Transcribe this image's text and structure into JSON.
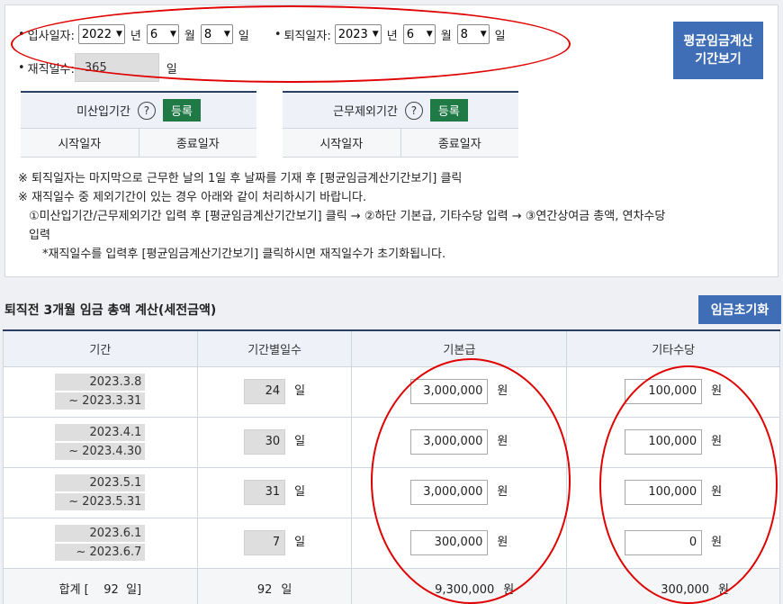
{
  "period": {
    "hire_label": "입사일자:",
    "hire_year": "2022",
    "hire_month": "6",
    "hire_day": "8",
    "leave_label": "퇴직일자:",
    "leave_year": "2023",
    "leave_month": "6",
    "leave_day": "8",
    "year_unit": "년",
    "month_unit": "월",
    "day_unit": "일",
    "service_label": "재직일수:",
    "service_days": "365",
    "service_unit": "일",
    "bullet": "•"
  },
  "avg_button": {
    "line1": "평균임금계산",
    "line2": "기간보기"
  },
  "excluded": {
    "unpaid": {
      "title": "미산입기간",
      "help": "?",
      "register": "등록",
      "start": "시작일자",
      "end": "종료일자"
    },
    "non_work": {
      "title": "근무제외기간",
      "help": "?",
      "register": "등록",
      "start": "시작일자",
      "end": "종료일자"
    }
  },
  "notes": {
    "line1": "※ 퇴직일자는 마지막으로 근무한 날의 1일 후 날짜를 기재 후 [평균임금계산기간보기] 클릭",
    "line2": "※ 재직일수 중 제외기간이 있는 경우 아래와 같이 처리하시기 바랍니다.",
    "line3": "①미산입기간/근무제외기간 입력 후 [평균임금계산기간보기] 클릭 → ②하단 기본급, 기타수당 입력 → ③연간상여금 총액, 연차수당",
    "line4": "입력",
    "line5": "*재직일수를 입력후 [평균임금계산기간보기] 클릭하시면 재직일수가 초기화됩니다."
  },
  "section": {
    "title": "퇴직전 3개월 임금 총액 계산(세전금액)",
    "reset": "임금초기화"
  },
  "table": {
    "headers": [
      "기간",
      "기간별일수",
      "기본급",
      "기타수당"
    ],
    "rows": [
      {
        "from": "2023.3.8",
        "to": "~ 2023.3.31",
        "days": "24",
        "base": "3,000,000",
        "other": "100,000"
      },
      {
        "from": "2023.4.1",
        "to": "~ 2023.4.30",
        "days": "30",
        "base": "3,000,000",
        "other": "100,000"
      },
      {
        "from": "2023.5.1",
        "to": "~ 2023.5.31",
        "days": "31",
        "base": "3,000,000",
        "other": "100,000"
      },
      {
        "from": "2023.6.1",
        "to": "~ 2023.6.7",
        "days": "7",
        "base": "300,000",
        "other": "0"
      }
    ],
    "day_unit": "일",
    "won_unit": "원",
    "total": {
      "label": "합계 [    92  일]",
      "days": "92",
      "base": "9,300,000",
      "other": "300,000"
    }
  }
}
